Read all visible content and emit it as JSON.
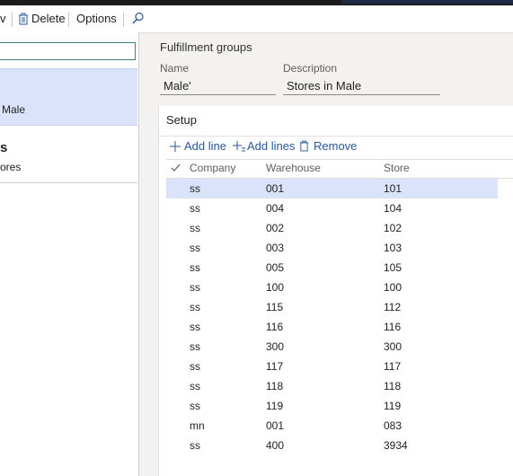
{
  "toolbar": {
    "partial_label": "v",
    "delete_label": "Delete",
    "options_label": "Options"
  },
  "left_list": {
    "selected": {
      "line1": "Male"
    },
    "second": {
      "title_fragment": "s",
      "subtitle_fragment": "ores"
    }
  },
  "detail": {
    "section_title": "Fulfillment groups",
    "name_label": "Name",
    "name_value": "Male'",
    "description_label": "Description",
    "description_value": "Stores in Male"
  },
  "setup": {
    "title": "Setup",
    "actions": {
      "add_line": "Add line",
      "add_lines": "Add lines",
      "remove": "Remove"
    },
    "columns": {
      "company": "Company",
      "warehouse": "Warehouse",
      "store": "Store"
    },
    "rows": [
      {
        "company": "ss",
        "warehouse": "001",
        "store": "101"
      },
      {
        "company": "ss",
        "warehouse": "004",
        "store": "104"
      },
      {
        "company": "ss",
        "warehouse": "002",
        "store": "102"
      },
      {
        "company": "ss",
        "warehouse": "003",
        "store": "103"
      },
      {
        "company": "ss",
        "warehouse": "005",
        "store": "105"
      },
      {
        "company": "ss",
        "warehouse": "100",
        "store": "100"
      },
      {
        "company": "ss",
        "warehouse": "115",
        "store": "112"
      },
      {
        "company": "ss",
        "warehouse": "116",
        "store": "116"
      },
      {
        "company": "ss",
        "warehouse": "300",
        "store": "300"
      },
      {
        "company": "ss",
        "warehouse": "117",
        "store": "117"
      },
      {
        "company": "ss",
        "warehouse": "118",
        "store": "118"
      },
      {
        "company": "ss",
        "warehouse": "119",
        "store": "119"
      },
      {
        "company": "mn",
        "warehouse": "001",
        "store": "083"
      },
      {
        "company": "ss",
        "warehouse": "400",
        "store": "3934"
      }
    ]
  },
  "colors": {
    "accent": "#2b579a",
    "selected_row": "#dbe3fb",
    "search_border": "#3c7f86"
  },
  "icons": [
    "trash-icon",
    "search-icon",
    "plus-icon",
    "add-lines-icon",
    "checkmark-icon"
  ]
}
